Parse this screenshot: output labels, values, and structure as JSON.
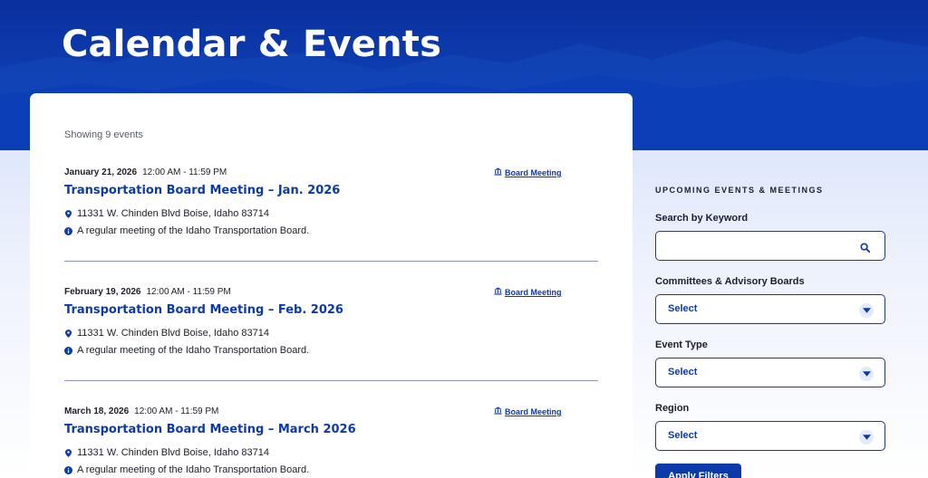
{
  "page": {
    "title": "Calendar & Events"
  },
  "results": {
    "count_text": "Showing 9 events"
  },
  "events": [
    {
      "date": "January 21, 2026",
      "time": "12:00 AM - 11:59 PM",
      "type": "Board Meeting",
      "type_icon": "building-icon",
      "title": "Transportation Board Meeting – Jan. 2026",
      "location": "11331 W. Chinden Blvd Boise, Idaho 83714",
      "description": "A regular meeting of the Idaho Transportation Board."
    },
    {
      "date": "February 19, 2026",
      "time": "12:00 AM - 11:59 PM",
      "type": "Board Meeting",
      "type_icon": "building-icon",
      "title": "Transportation Board Meeting – Feb. 2026",
      "location": "11331 W. Chinden Blvd Boise, Idaho 83714",
      "description": "A regular meeting of the Idaho Transportation Board."
    },
    {
      "date": "March 18, 2026",
      "time": "12:00 AM - 11:59 PM",
      "type": "Board Meeting",
      "type_icon": "building-icon",
      "title": "Transportation Board Meeting – March 2026",
      "location": "11331 W. Chinden Blvd Boise, Idaho 83714",
      "description": "A regular meeting of the Idaho Transportation Board."
    }
  ],
  "filters": {
    "heading": "UPCOMING EVENTS & MEETINGS",
    "keyword": {
      "label": "Search by Keyword",
      "value": "",
      "placeholder": ""
    },
    "committees": {
      "label": "Committees & Advisory Boards",
      "value": "Select"
    },
    "event_type": {
      "label": "Event Type",
      "value": "Select"
    },
    "region": {
      "label": "Region",
      "value": "Select"
    },
    "apply_label": "Apply Filters"
  },
  "colors": {
    "brand_blue": "#0c3aa8",
    "hero_blue": "#0d3fb5",
    "divider": "#8b95b7"
  }
}
